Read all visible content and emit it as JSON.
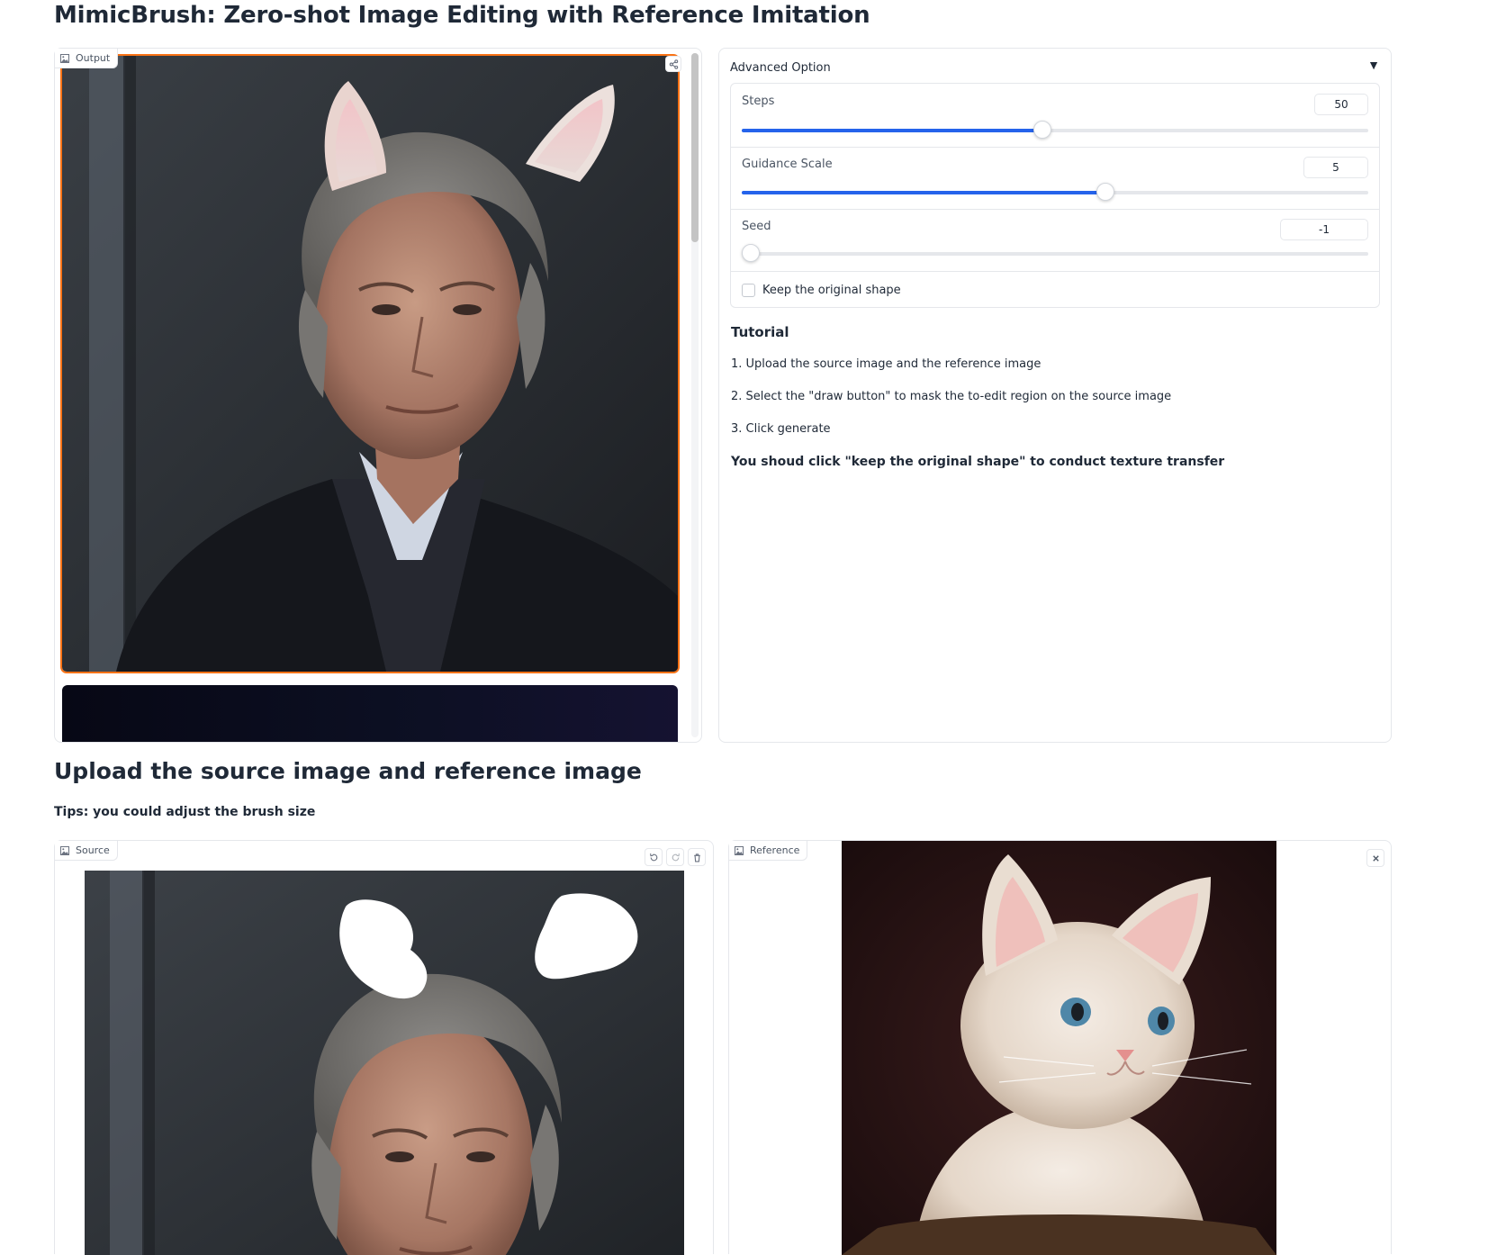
{
  "app": {
    "title": "MimicBrush: Zero-shot Image Editing with Reference Imitation"
  },
  "output": {
    "label": "Output",
    "image_icon": "image-icon",
    "share_icon": "share-icon"
  },
  "advanced": {
    "title": "Advanced Option",
    "toggle_glyph": "▼",
    "steps": {
      "label": "Steps",
      "value": "50",
      "fraction": 0.48
    },
    "guidance": {
      "label": "Guidance Scale",
      "value": "5",
      "fraction": 0.58
    },
    "seed": {
      "label": "Seed",
      "value": "-1",
      "fraction": 0.0
    },
    "keep_shape": {
      "label": "Keep the original shape",
      "checked": false
    }
  },
  "tutorial": {
    "heading": "Tutorial",
    "steps": [
      "1. Upload the source image and the reference image",
      "2. Select the \"draw button\" to mask the to-edit region on the source image",
      "3. Click generate"
    ],
    "note": "You shoud click \"keep the original shape\" to conduct texture transfer"
  },
  "upload": {
    "heading": "Upload the source image and reference image",
    "tips": "Tips: you could adjust the brush size"
  },
  "source": {
    "label": "Source",
    "undo_icon": "undo-icon",
    "redo_icon": "redo-icon",
    "trash_icon": "trash-icon"
  },
  "reference": {
    "label": "Reference",
    "close_icon": "close-icon"
  },
  "colors": {
    "accent": "#2563eb",
    "focus_border": "#f97316",
    "border": "#e5e7eb"
  }
}
